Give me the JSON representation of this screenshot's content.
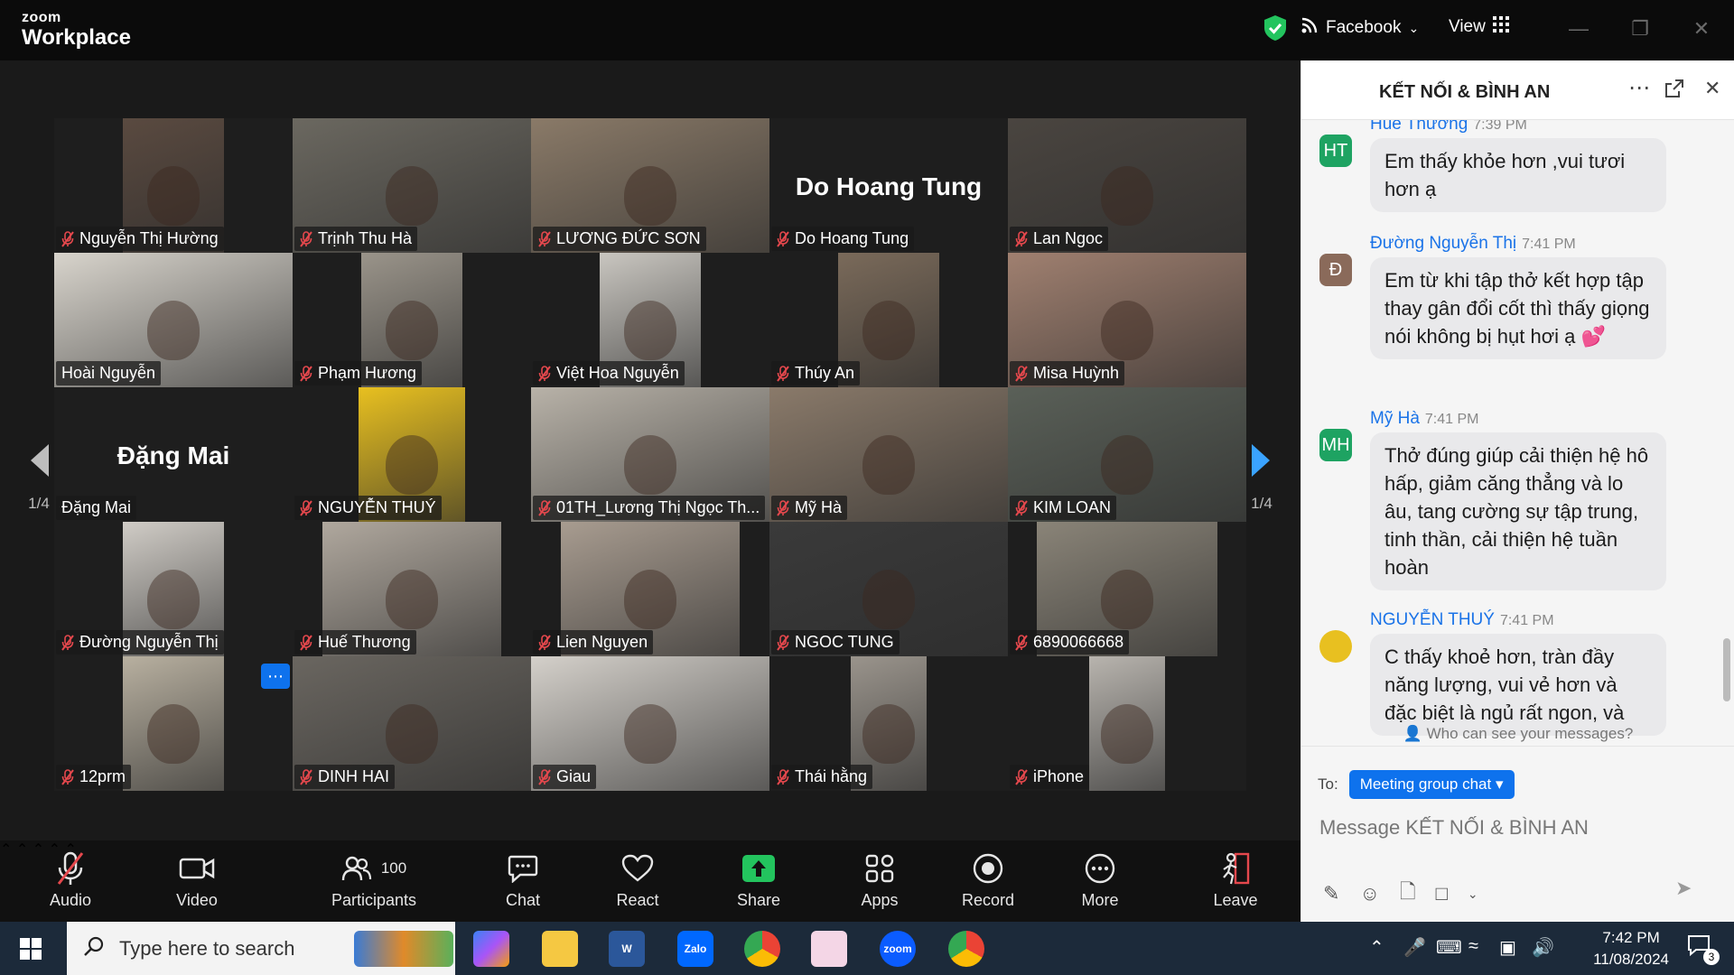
{
  "app": {
    "brand_small": "zoom",
    "brand_big": "Workplace"
  },
  "topbar": {
    "stream_label": "Facebook",
    "view_label": "View"
  },
  "pager": {
    "left": "1/4",
    "right": "1/4"
  },
  "participants": [
    {
      "name": "Nguyễn Thị Hường",
      "bg": "#5a4a40",
      "muted": true
    },
    {
      "name": "Trịnh Thu Hà",
      "bg": "#6b6860",
      "muted": true
    },
    {
      "name": "LƯƠNG ĐỨC SƠN",
      "bg": "#8a7a68",
      "muted": true
    },
    {
      "name": "Do Hoang Tung",
      "big": "Do Hoang Tung",
      "bg": "#1e1e1e",
      "muted": true
    },
    {
      "name": "Lan Ngoc",
      "bg": "#4a4540",
      "muted": true
    },
    {
      "name": "Hoài Nguyễn",
      "bg": "#d8d4cc",
      "muted": false,
      "active": true
    },
    {
      "name": "Phạm Hương",
      "bg": "#9a948a",
      "muted": true
    },
    {
      "name": "Việt Hoa Nguyễn",
      "bg": "#c9c6c0",
      "muted": true
    },
    {
      "name": "Thúy An",
      "bg": "#7a6a5a",
      "muted": true
    },
    {
      "name": "Misa Huỳnh",
      "bg": "#a08070",
      "muted": true
    },
    {
      "name": "Đặng Mai",
      "big": "Đặng Mai",
      "bg": "#1e1e1e",
      "muted": false
    },
    {
      "name": "NGUYỄN THUÝ",
      "bg": "#e8c020",
      "muted": true
    },
    {
      "name": "01TH_Lương Thị Ngọc Th...",
      "bg": "#b8b2a8",
      "muted": true
    },
    {
      "name": "Mỹ Hà",
      "bg": "#8a7a6a",
      "muted": true
    },
    {
      "name": "KIM LOAN",
      "bg": "#5a6058",
      "muted": true
    },
    {
      "name": "Đường Nguyễn Thị",
      "bg": "#d0ccc6",
      "muted": true
    },
    {
      "name": "Huế Thương",
      "bg": "#b0a89e",
      "muted": true
    },
    {
      "name": "Lien Nguyen",
      "bg": "#a89c90",
      "muted": true
    },
    {
      "name": "NGOC TUNG",
      "bg": "#3a3a3a",
      "muted": true
    },
    {
      "name": "6890066668",
      "bg": "#8a8478",
      "muted": true
    },
    {
      "name": "12prm",
      "bg": "#b8b0a0",
      "muted": true
    },
    {
      "name": "DINH HAI",
      "bg": "#6a6660",
      "muted": true
    },
    {
      "name": "Giau",
      "bg": "#d4d0ca",
      "muted": true
    },
    {
      "name": "Thái hằng",
      "bg": "#9a948c",
      "muted": true
    },
    {
      "name": "iPhone",
      "bg": "#b8b4ae",
      "muted": true
    }
  ],
  "toolbar": {
    "audio": "Audio",
    "video": "Video",
    "participants": "Participants",
    "participants_count": "100",
    "chat": "Chat",
    "react": "React",
    "share": "Share",
    "apps": "Apps",
    "record": "Record",
    "more": "More",
    "leave": "Leave"
  },
  "chat": {
    "title": "KẾT NỐI & BÌNH AN",
    "messages": [
      {
        "sender": "Huế Thương",
        "time": "7:39 PM",
        "initials": "HT",
        "color": "#1ea362",
        "text": "Em thấy khỏe hơn ,vui tươi hơn ạ"
      },
      {
        "sender": "Đường Nguyễn Thị",
        "time": "7:41 PM",
        "initials": "Đ",
        "color": "#8a6a5a",
        "text": "Em từ khi tập thở kết hợp tập thay gân đổi cốt thì thấy giọng nói không bị hụt hơi ạ 💕"
      },
      {
        "sender": "Mỹ Hà",
        "time": "7:41 PM",
        "initials": "MH",
        "color": "#1ea362",
        "text": "Thở đúng giúp cải thiện hệ hô hấp, giảm căng thẳng và lo âu, tang cường sự tập trung, tinh thần, cải thiện hệ tuần hoàn"
      },
      {
        "sender": "NGUYỄN THUÝ",
        "time": "7:41 PM",
        "initials": "",
        "color": "#e8c020",
        "text": "C thấy khoẻ hơn, tràn đầy năng lượng, vui vẻ hơn và đặc biệt là ngủ rất ngon, và"
      }
    ],
    "visibility": "Who can see your messages?",
    "to_label": "To:",
    "to_value": "Meeting group chat",
    "input_placeholder": "Message KẾT NỐI & BÌNH AN"
  },
  "taskbar": {
    "search_placeholder": "Type here to search",
    "time": "7:42 PM",
    "date": "11/08/2024",
    "notifications": "3"
  }
}
